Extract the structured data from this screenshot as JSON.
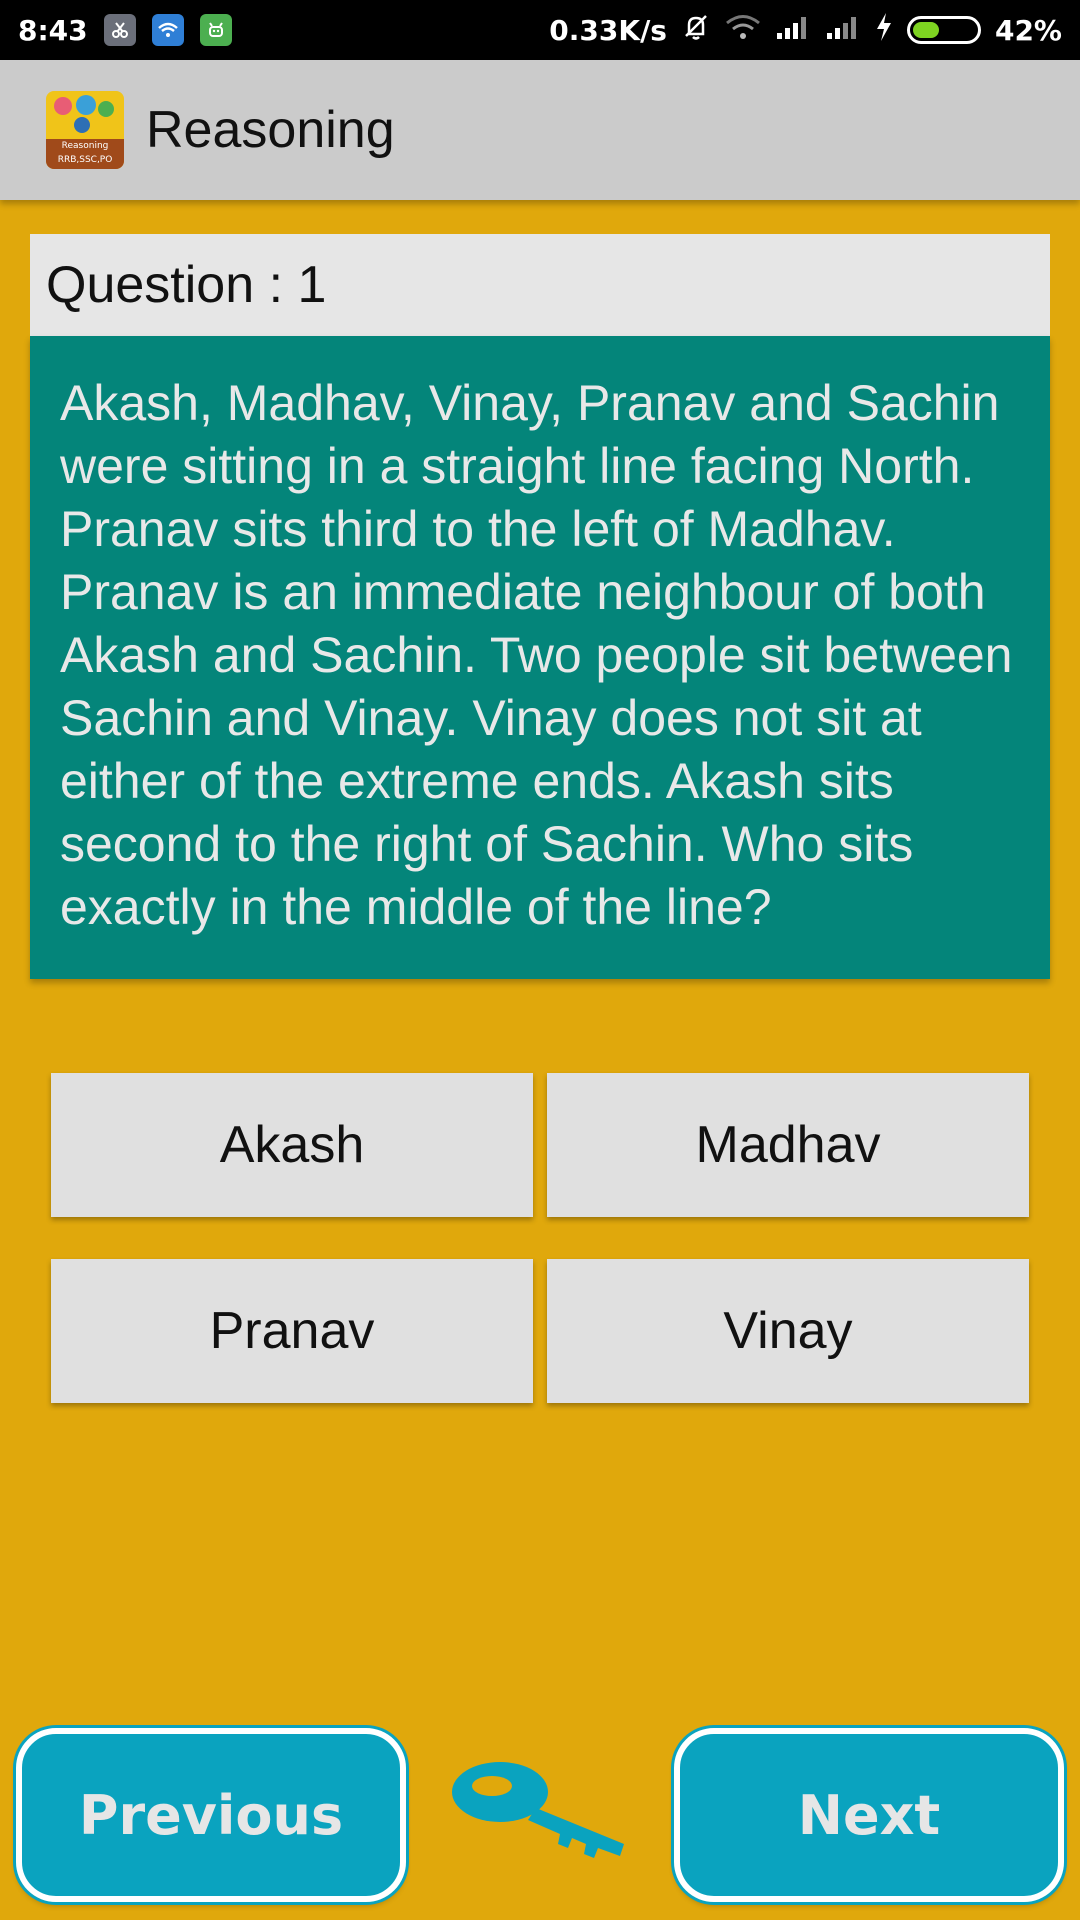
{
  "status_bar": {
    "time": "8:43",
    "network_speed": "0.33K/s",
    "battery_percent": "42%",
    "battery_level": 0.42
  },
  "app_bar": {
    "title": "Reasoning",
    "logo_text": "Reasoning RRB,SSC,PO"
  },
  "question": {
    "header": "Question : 1",
    "text": "Akash, Madhav, Vinay, Pranav and Sachin were sitting in a straight line facing North. Pranav sits third to the left of Madhav. Pranav is an immediate neighbour of both Akash and Sachin. Two people sit between Sachin and Vinay. Vinay does not sit at either of the extreme ends. Akash sits second to the right of Sachin. Who sits exactly in the middle of the line?"
  },
  "options": [
    "Akash",
    "Madhav",
    "Pranav",
    "Vinay"
  ],
  "navigation": {
    "previous_label": "Previous",
    "next_label": "Next"
  },
  "icons": {
    "answer_key": "key-icon"
  },
  "colors": {
    "background": "#e0a80c",
    "question_body": "#04857a",
    "nav_button": "#0aa3bf",
    "key": "#0aa3bf"
  }
}
